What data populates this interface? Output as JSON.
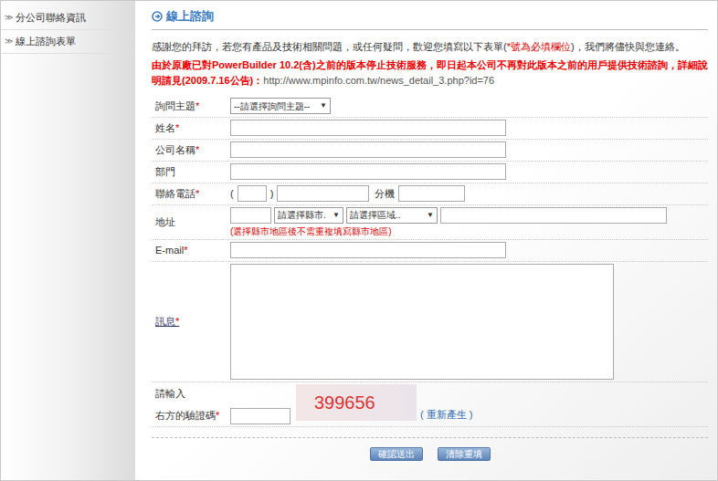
{
  "sidebar": {
    "items": [
      {
        "icon": "≫",
        "label": "分公司聯絡資訊"
      },
      {
        "icon": "≫",
        "label": "線上諮詢表單"
      }
    ]
  },
  "title": "線上諮詢",
  "intro": {
    "before": "感謝您的拜訪，若您有產品及技術相關問題，或任何疑問，歡迎您填寫以下表單(",
    "required": "*號為必填欄位",
    "after": ")，我們將儘快與您連絡。"
  },
  "notice": {
    "text": "由於原廠已對PowerBuilder 10.2(含)之前的版本停止技術服務，即日起本公司不再對此版本之前的用戶提供技術諮詢，詳細說明請見(2009.7.16公告)：",
    "url": "http://www.mpinfo.com.tw/news_detail_3.php?id=76"
  },
  "required_mark": "*",
  "select_arrow": "▼",
  "form": {
    "fields": [
      {
        "kind": "select",
        "label": "詢問主題",
        "required": true,
        "link": false,
        "value": "--請選擇詢問主題--"
      },
      {
        "kind": "text",
        "label": "姓名",
        "required": true,
        "link": false
      },
      {
        "kind": "text",
        "label": "公司名稱",
        "required": true,
        "link": false
      },
      {
        "kind": "text",
        "label": "部門",
        "required": false,
        "link": false
      },
      {
        "kind": "phone",
        "label": "聯絡電話",
        "required": true,
        "link": false,
        "open": "(",
        "close": ")",
        "ext": "分機"
      },
      {
        "kind": "address",
        "label": "地址",
        "required": false,
        "link": false,
        "city": "請選擇縣市.",
        "district": "請選擇區域..",
        "note": "(選擇縣市地區後不需重複填寫縣市地區)"
      },
      {
        "kind": "text",
        "label": "E-mail",
        "required": true,
        "link": false
      },
      {
        "kind": "textarea",
        "label": "訊息",
        "required": true,
        "link": true
      },
      {
        "kind": "captcha",
        "label": "請輸入",
        "label2": "右方的驗證碼",
        "required": true,
        "link": false,
        "code": "399656",
        "regen_open": "(",
        "regen": "重新產生",
        "regen_close": ")"
      }
    ]
  },
  "buttons": [
    "確認送出",
    "清除重填"
  ]
}
